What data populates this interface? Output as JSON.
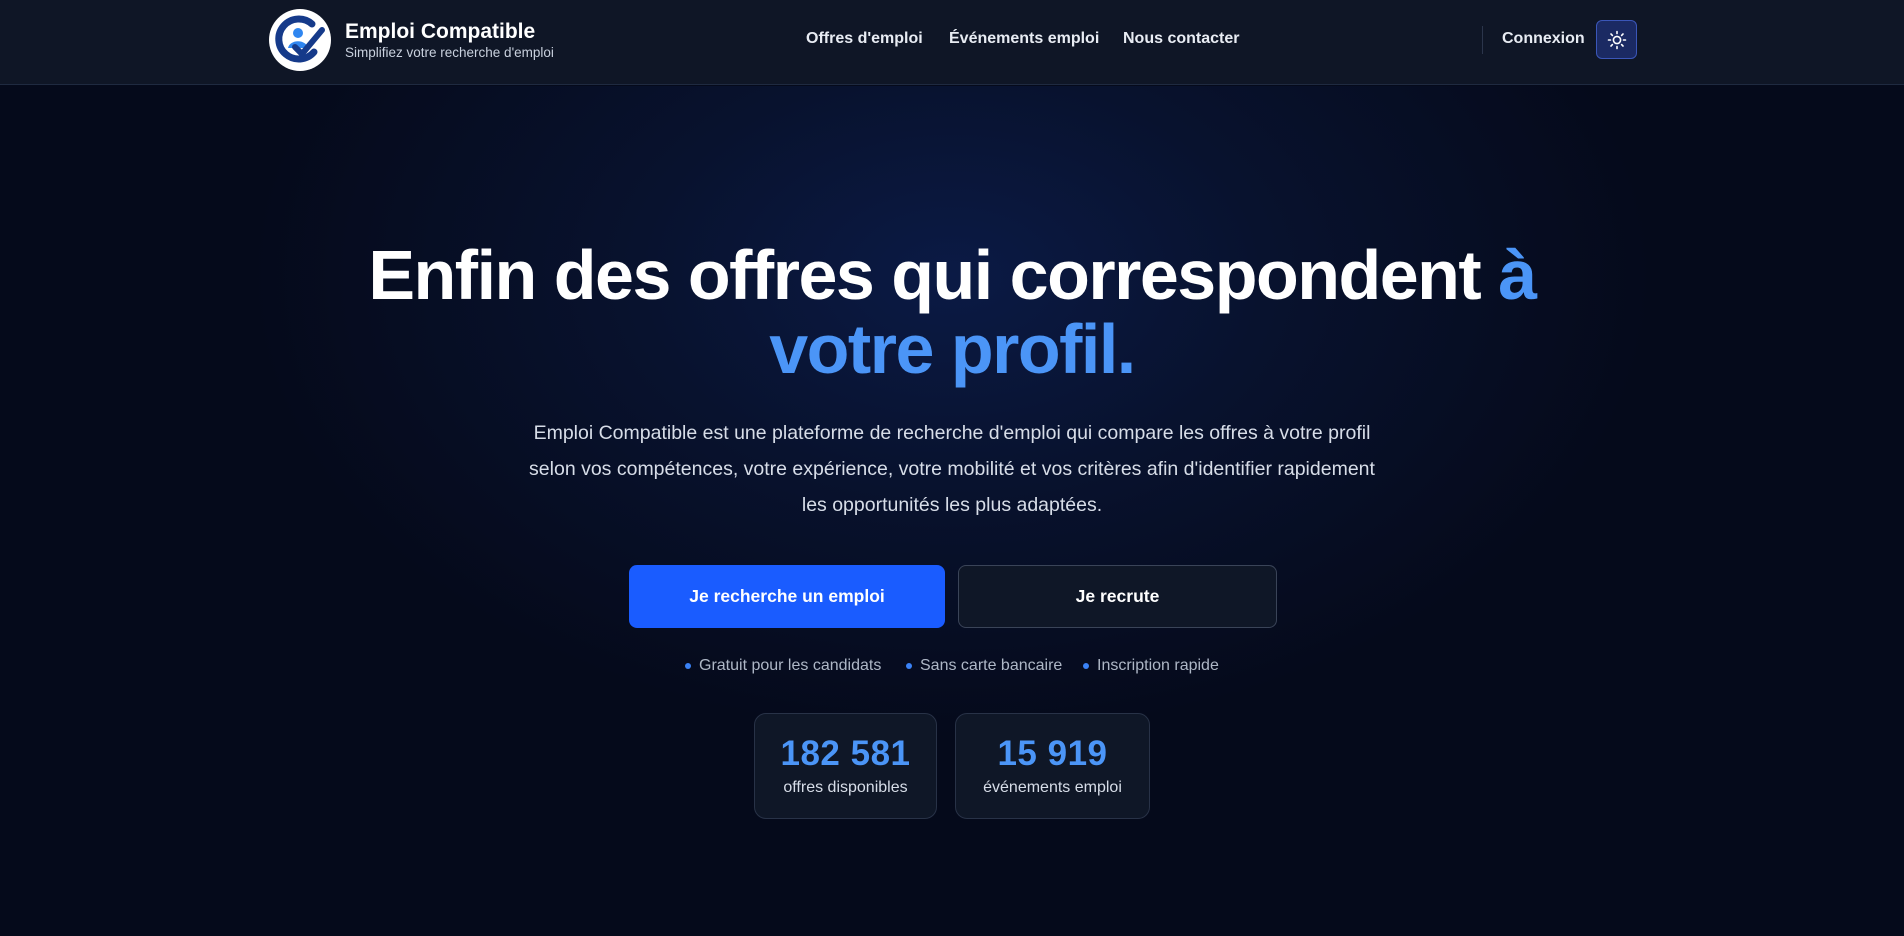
{
  "brand": {
    "title": "Emploi Compatible",
    "subtitle": "Simplifiez votre recherche d'emploi",
    "logo_icon": "person-checkmark-logo"
  },
  "nav": {
    "links": [
      "Offres d'emploi",
      "Événements emploi",
      "Nous contacter"
    ],
    "login": "Connexion",
    "theme_icon": "sun-icon"
  },
  "hero": {
    "title_main": "Enfin des offres qui correspondent",
    "title_accent_1": "à",
    "title_accent_2": "votre profil.",
    "description": "Emploi Compatible est une plateforme de recherche d'emploi qui compare les offres à votre profil selon vos compétences, votre expérience, votre mobilité et vos critères afin d'identifier rapidement les opportunités les plus adaptées.",
    "primary_button": "Je recherche un emploi",
    "secondary_button": "Je recrute",
    "perks": [
      "Gratuit pour les candidats",
      "Sans carte bancaire",
      "Inscription rapide"
    ]
  },
  "stats": [
    {
      "value": "182 581",
      "label": "offres disponibles"
    },
    {
      "value": "15 919",
      "label": "événements emploi"
    }
  ],
  "colors": {
    "background": "#050a1b",
    "header": "#0f1626",
    "accent": "#4b95f7",
    "primary_button": "#1a5cff"
  }
}
